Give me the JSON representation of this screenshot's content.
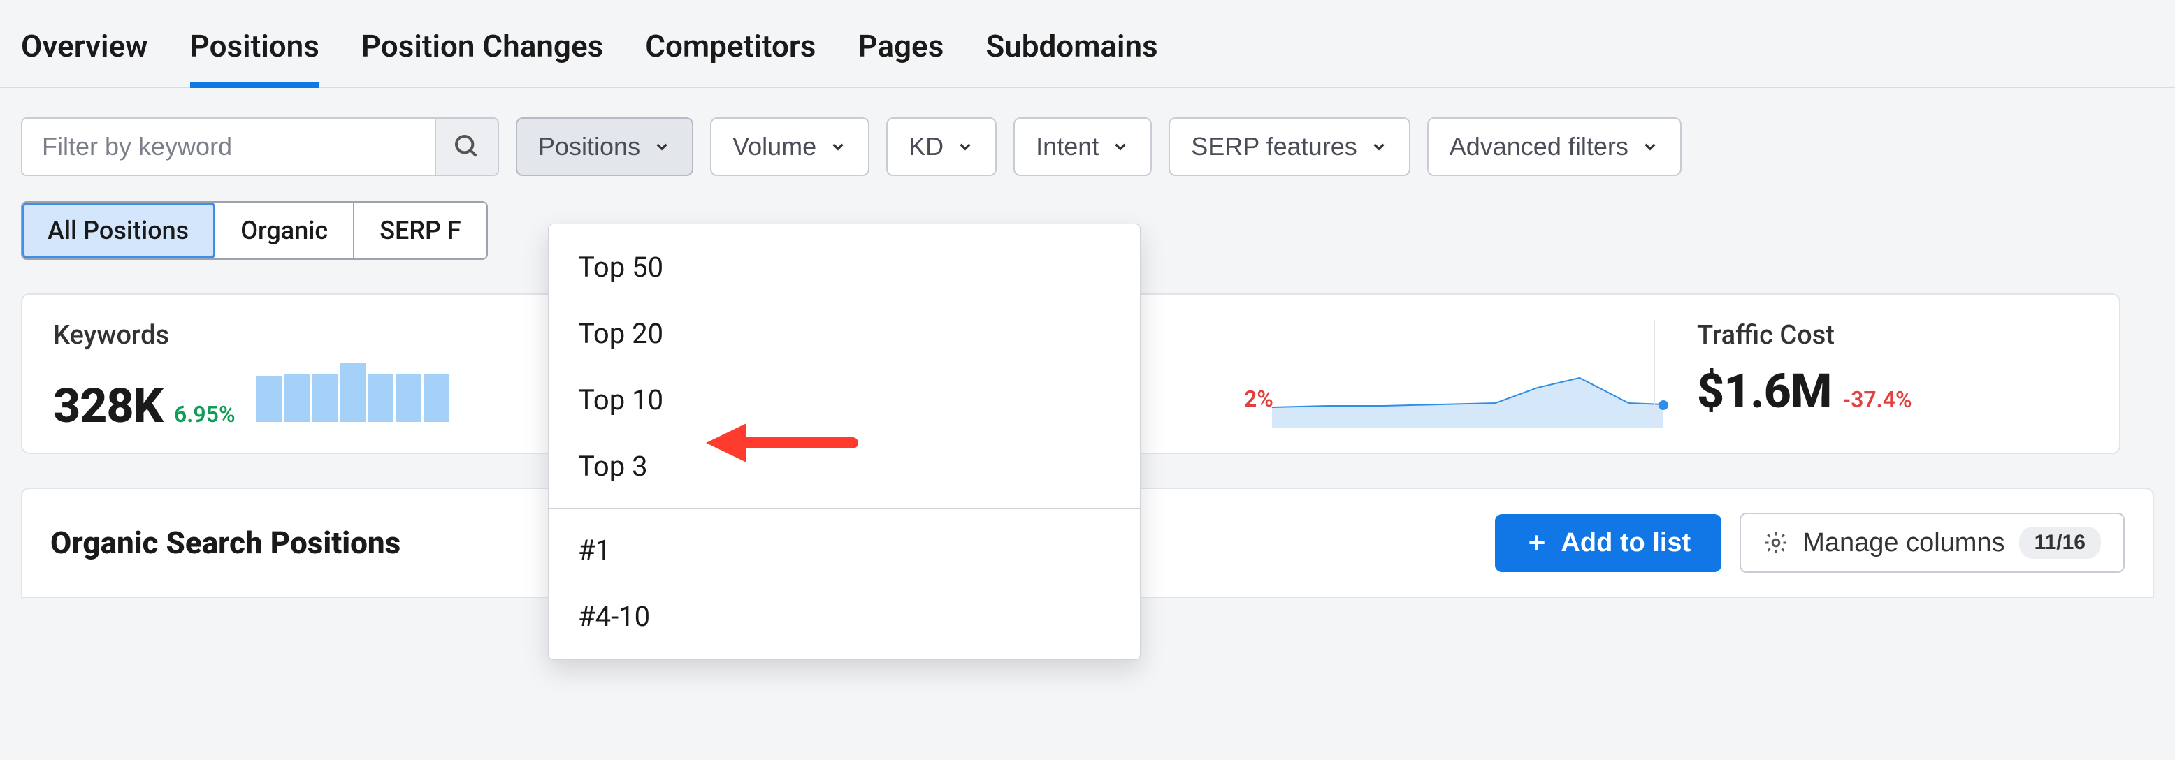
{
  "tabs": {
    "overview": "Overview",
    "positions": "Positions",
    "position_changes": "Position Changes",
    "competitors": "Competitors",
    "pages": "Pages",
    "subdomains": "Subdomains"
  },
  "filters": {
    "keyword_placeholder": "Filter by keyword",
    "positions": "Positions",
    "volume": "Volume",
    "kd": "KD",
    "intent": "Intent",
    "serp_features": "SERP features",
    "advanced": "Advanced filters"
  },
  "segmented": {
    "all": "All Positions",
    "organic": "Organic",
    "serp": "SERP F"
  },
  "dropdown": {
    "top50": "Top 50",
    "top20": "Top 20",
    "top10": "Top 10",
    "top3": "Top 3",
    "n1": "#1",
    "n4_10": "#4-10"
  },
  "metrics": {
    "keywords_label": "Keywords",
    "keywords_value": "328K",
    "keywords_delta": "6.95%",
    "mid_delta": "2%",
    "traffic_cost_label": "Traffic Cost",
    "traffic_cost_value": "$1.6M",
    "traffic_cost_delta": "-37.4%"
  },
  "section": {
    "title": "Organic Search Positions",
    "add_to_list": "Add to list",
    "manage_columns": "Manage columns",
    "columns_badge": "11/16"
  },
  "chart_data": {
    "type": "bar",
    "note": "Keywords sparkline — relative bar heights, no axis shown",
    "values": [
      78,
      80,
      80,
      92,
      80,
      80,
      80
    ]
  }
}
